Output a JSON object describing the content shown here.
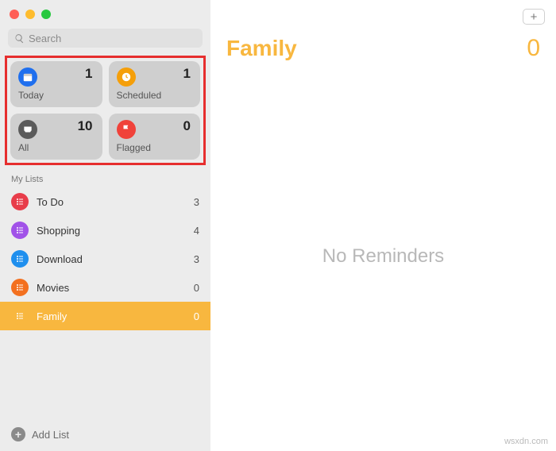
{
  "search": {
    "placeholder": "Search"
  },
  "cards": {
    "today": {
      "label": "Today",
      "count": "1",
      "color": "#1f6fee"
    },
    "scheduled": {
      "label": "Scheduled",
      "count": "1",
      "color": "#f59f0a"
    },
    "all": {
      "label": "All",
      "count": "10",
      "color": "#5b5b5b"
    },
    "flagged": {
      "label": "Flagged",
      "count": "0",
      "color": "#f0423a"
    }
  },
  "section_label": "My Lists",
  "lists": [
    {
      "name": "To Do",
      "count": "3",
      "color": "#e83d4a",
      "selected": false
    },
    {
      "name": "Shopping",
      "count": "4",
      "color": "#a152e8",
      "selected": false
    },
    {
      "name": "Download",
      "count": "3",
      "color": "#1f8fee",
      "selected": false
    },
    {
      "name": "Movies",
      "count": "0",
      "color": "#f3701f",
      "selected": false
    },
    {
      "name": "Family",
      "count": "0",
      "color": "#f8b73f",
      "selected": true
    }
  ],
  "footer": {
    "add_list": "Add List"
  },
  "main": {
    "title": "Family",
    "count": "0",
    "empty_text": "No Reminders",
    "accent": "#f8b73f"
  },
  "watermark": "wsxdn.com"
}
